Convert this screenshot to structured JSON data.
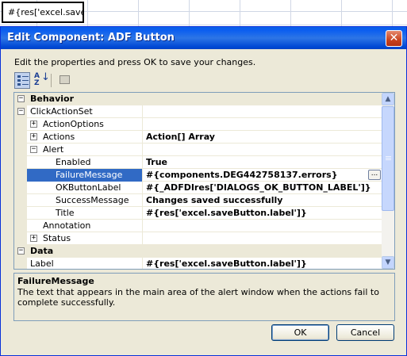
{
  "cell": {
    "text": "#{res['excel.saveB"
  },
  "dialog": {
    "title": "Edit Component: ADF Button",
    "close_glyph": "✕",
    "instructions": "Edit the properties and press OK to save your changes.",
    "ok_label": "OK",
    "cancel_label": "Cancel"
  },
  "toolbar": {
    "categorized_icon": "categorized-view-icon",
    "alphabetical_icon": "alphabetical-sort-icon",
    "alpha_top": "A",
    "alpha_bottom": "Z",
    "alpha_arrow": "↓",
    "pages_icon": "property-pages-icon"
  },
  "grid": {
    "rows": [
      {
        "type": "category",
        "name": "Behavior",
        "expander": "⊟"
      },
      {
        "type": "prop",
        "indent": 0,
        "name": "ClickActionSet",
        "value": "",
        "expander": "⊟"
      },
      {
        "type": "prop",
        "indent": 1,
        "name": "ActionOptions",
        "value": "",
        "expander": "⊞"
      },
      {
        "type": "prop",
        "indent": 1,
        "name": "Actions",
        "value": "Action[] Array",
        "expander": "⊞"
      },
      {
        "type": "prop",
        "indent": 1,
        "name": "Alert",
        "value": "",
        "expander": "⊟"
      },
      {
        "type": "prop",
        "indent": 2,
        "name": "Enabled",
        "value": "True"
      },
      {
        "type": "prop",
        "indent": 2,
        "name": "FailureMessage",
        "value": "#{components.DEG442758137.errors}",
        "selected": true,
        "ellipsis": "..."
      },
      {
        "type": "prop",
        "indent": 2,
        "name": "OKButtonLabel",
        "value": "#{_ADFDIres['DIALOGS_OK_BUTTON_LABEL']}"
      },
      {
        "type": "prop",
        "indent": 2,
        "name": "SuccessMessage",
        "value": "Changes saved successfully"
      },
      {
        "type": "prop",
        "indent": 2,
        "name": "Title",
        "value": "#{res['excel.saveButton.label']}"
      },
      {
        "type": "prop",
        "indent": 1,
        "name": "Annotation",
        "value": ""
      },
      {
        "type": "prop",
        "indent": 1,
        "name": "Status",
        "value": "",
        "expander": "⊞"
      },
      {
        "type": "category",
        "name": "Data",
        "expander": "⊟"
      },
      {
        "type": "prop",
        "indent": 0,
        "name": "Label",
        "value": "#{res['excel.saveButton.label']}"
      }
    ]
  },
  "scrollbar": {
    "up": "▲",
    "down": "▼"
  },
  "description": {
    "title": "FailureMessage",
    "text": "The text that appears in the main area of the alert window when the actions fail to complete successfully."
  },
  "colors": {
    "title_bar": "#0054e3",
    "selection": "#316ac5",
    "dialog_face": "#ece9d8"
  }
}
